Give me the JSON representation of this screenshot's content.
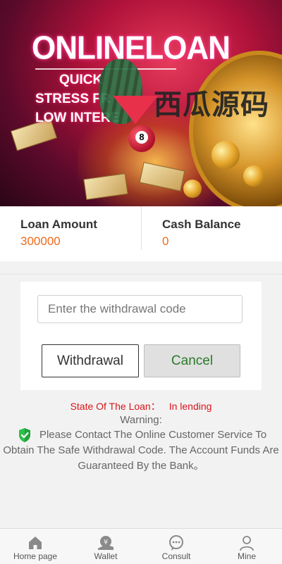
{
  "banner": {
    "title": "ONLINELOAN",
    "lines": [
      "QUICK",
      "STRESS FR",
      "LOW INTERE"
    ],
    "ball_number": "8",
    "watermark": "西瓜源码"
  },
  "stats": {
    "loan_amount_label": "Loan Amount",
    "loan_amount_value": "300000",
    "cash_balance_label": "Cash Balance",
    "cash_balance_value": "0"
  },
  "withdraw": {
    "code_placeholder": "Enter the withdrawal code",
    "withdraw_label": "Withdrawal",
    "cancel_label": "Cancel"
  },
  "status": {
    "state_label": "State Of The Loan：",
    "state_value": "In lending",
    "warning_title": "Warning:",
    "warning_text": "Please Contact The Online Customer Service To Obtain The Safe Withdrawal Code. The Account Funds Are Guaranteed By the Bank。"
  },
  "nav": {
    "items": [
      {
        "label": "Home page",
        "icon": "home-icon"
      },
      {
        "label": "Wallet",
        "icon": "wallet-icon"
      },
      {
        "label": "Consult",
        "icon": "chat-icon"
      },
      {
        "label": "Mine",
        "icon": "user-icon"
      }
    ]
  },
  "colors": {
    "accent_orange": "#ef6a1a",
    "status_red": "#d9141b",
    "cancel_green": "#2a7a2a",
    "shield_green": "#22a33a"
  }
}
